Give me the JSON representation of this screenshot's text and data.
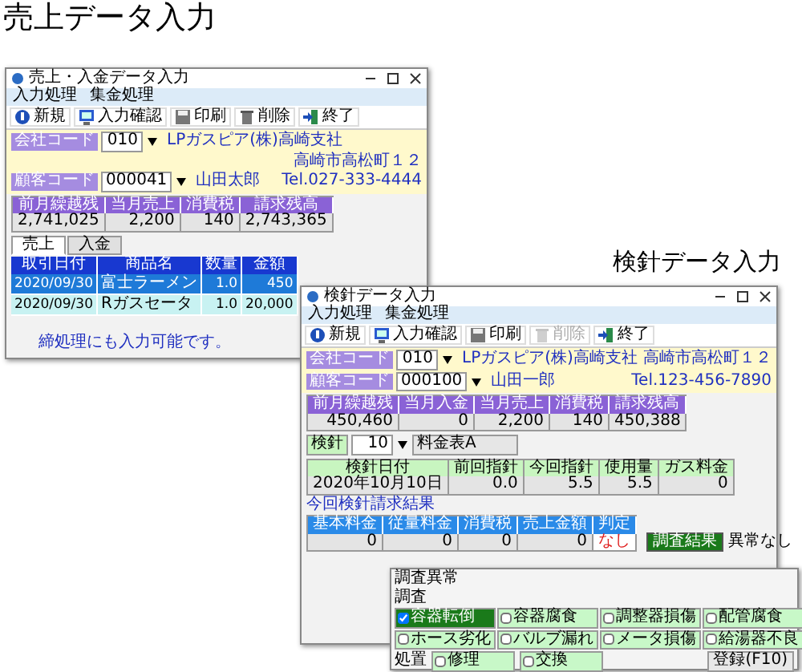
{
  "captions": [
    "売上データ入力",
    "検針データ入力"
  ],
  "sales_window": {
    "title": "売上・入金データ入力",
    "menu": [
      "入力処理",
      "集金処理"
    ],
    "toolbar": [
      {
        "kind": "new",
        "label": "新規",
        "disabled": false
      },
      {
        "kind": "check",
        "label": "入力確認",
        "disabled": false
      },
      {
        "kind": "save",
        "label": "印刷",
        "disabled": false
      },
      {
        "kind": "delete",
        "label": "削除",
        "disabled": false
      },
      {
        "kind": "exit",
        "label": "終了",
        "disabled": false
      }
    ],
    "customer": {
      "company_label": "会社コード",
      "company_code": "010",
      "company_name": "LPガスピア(株)高崎支社",
      "address": "高崎市高松町１２",
      "customer_label": "顧客コード",
      "customer_code": "000041",
      "customer_name": "山田太郎",
      "tel": "Tel.027-333-4444"
    },
    "summary": [
      {
        "label": "前月繰越残",
        "value": "2,741,025"
      },
      {
        "label": "当月売上",
        "value": "2,200"
      },
      {
        "label": "消費税",
        "value": "140"
      },
      {
        "label": "請求残高",
        "value": "2,743,365"
      }
    ],
    "tabs": [
      {
        "label": "売上",
        "selected": true
      },
      {
        "label": "入金",
        "selected": false
      }
    ],
    "table": {
      "columns": [
        "取引日付",
        "商品名",
        "数量",
        "金額"
      ],
      "rows": [
        {
          "selected": true,
          "cells": [
            "2020/09/30",
            "富士ラーメン",
            "1.0",
            "450"
          ]
        },
        {
          "selected": false,
          "cells": [
            "2020/09/30",
            "Rガスセータ",
            "1.0",
            "20,000"
          ]
        }
      ]
    },
    "message": "締処理にも入力可能です。"
  },
  "meter_window": {
    "title": "検針データ入力",
    "menu": [
      "入力処理",
      "集金処理"
    ],
    "toolbar": [
      {
        "kind": "new",
        "label": "新規",
        "disabled": false
      },
      {
        "kind": "check",
        "label": "入力確認",
        "disabled": false
      },
      {
        "kind": "save",
        "label": "印刷",
        "disabled": false
      },
      {
        "kind": "delete",
        "label": "削除",
        "disabled": true
      },
      {
        "kind": "exit",
        "label": "終了",
        "disabled": false
      }
    ],
    "customer": {
      "company_label": "会社コード",
      "company_code": "010",
      "company_name": "LPガスピア(株)高崎支社",
      "address": "高崎市高松町１２",
      "customer_label": "顧客コード",
      "customer_code": "000100",
      "customer_name": "山田一郎",
      "tel": "Tel.123-456-7890"
    },
    "summary": [
      {
        "label": "前月繰越残",
        "value": "450,460"
      },
      {
        "label": "当月入金",
        "value": "0"
      },
      {
        "label": "当月売上",
        "value": "2,200"
      },
      {
        "label": "消費税",
        "value": "140"
      },
      {
        "label": "請求残高",
        "value": "450,388"
      }
    ],
    "meter_label": "検針",
    "meter_code": "10",
    "meter_name": "料金表A",
    "readings": [
      {
        "label": "検針日付",
        "value": "2020年10月10日"
      },
      {
        "label": "前回指針",
        "value": "0.0"
      },
      {
        "label": "今回指針",
        "value": "5.5"
      },
      {
        "label": "使用量",
        "value": "5.5"
      },
      {
        "label": "ガス料金",
        "value": "0"
      }
    ],
    "result_label": "今回検針請求結果",
    "results": [
      {
        "label": "基本料金",
        "value": "0",
        "alert": false
      },
      {
        "label": "従量料金",
        "value": "0",
        "alert": false
      },
      {
        "label": "消費税",
        "value": "0",
        "alert": false
      },
      {
        "label": "売上金額",
        "value": "0",
        "alert": false
      },
      {
        "label": "判定",
        "value": "なし",
        "alert": true
      }
    ],
    "survey_button": "調査結果",
    "survey_status": "異常なし",
    "dialog": {
      "title": "調査異常",
      "section": "調査",
      "checks": [
        {
          "label": "容器転倒",
          "checked": true
        },
        {
          "label": "容器腐食",
          "checked": false
        },
        {
          "label": "調整器損傷",
          "checked": false
        },
        {
          "label": "配管腐食",
          "checked": false
        },
        {
          "label": "ホース劣化",
          "checked": false
        },
        {
          "label": "バルブ漏れ",
          "checked": false
        },
        {
          "label": "メータ損傷",
          "checked": false
        },
        {
          "label": "給湯器不良",
          "checked": false
        }
      ],
      "action_section": "処置",
      "actions": [
        {
          "label": "修理",
          "checked": false
        },
        {
          "label": "交換",
          "checked": false
        }
      ],
      "button": "登録(F10)"
    }
  }
}
